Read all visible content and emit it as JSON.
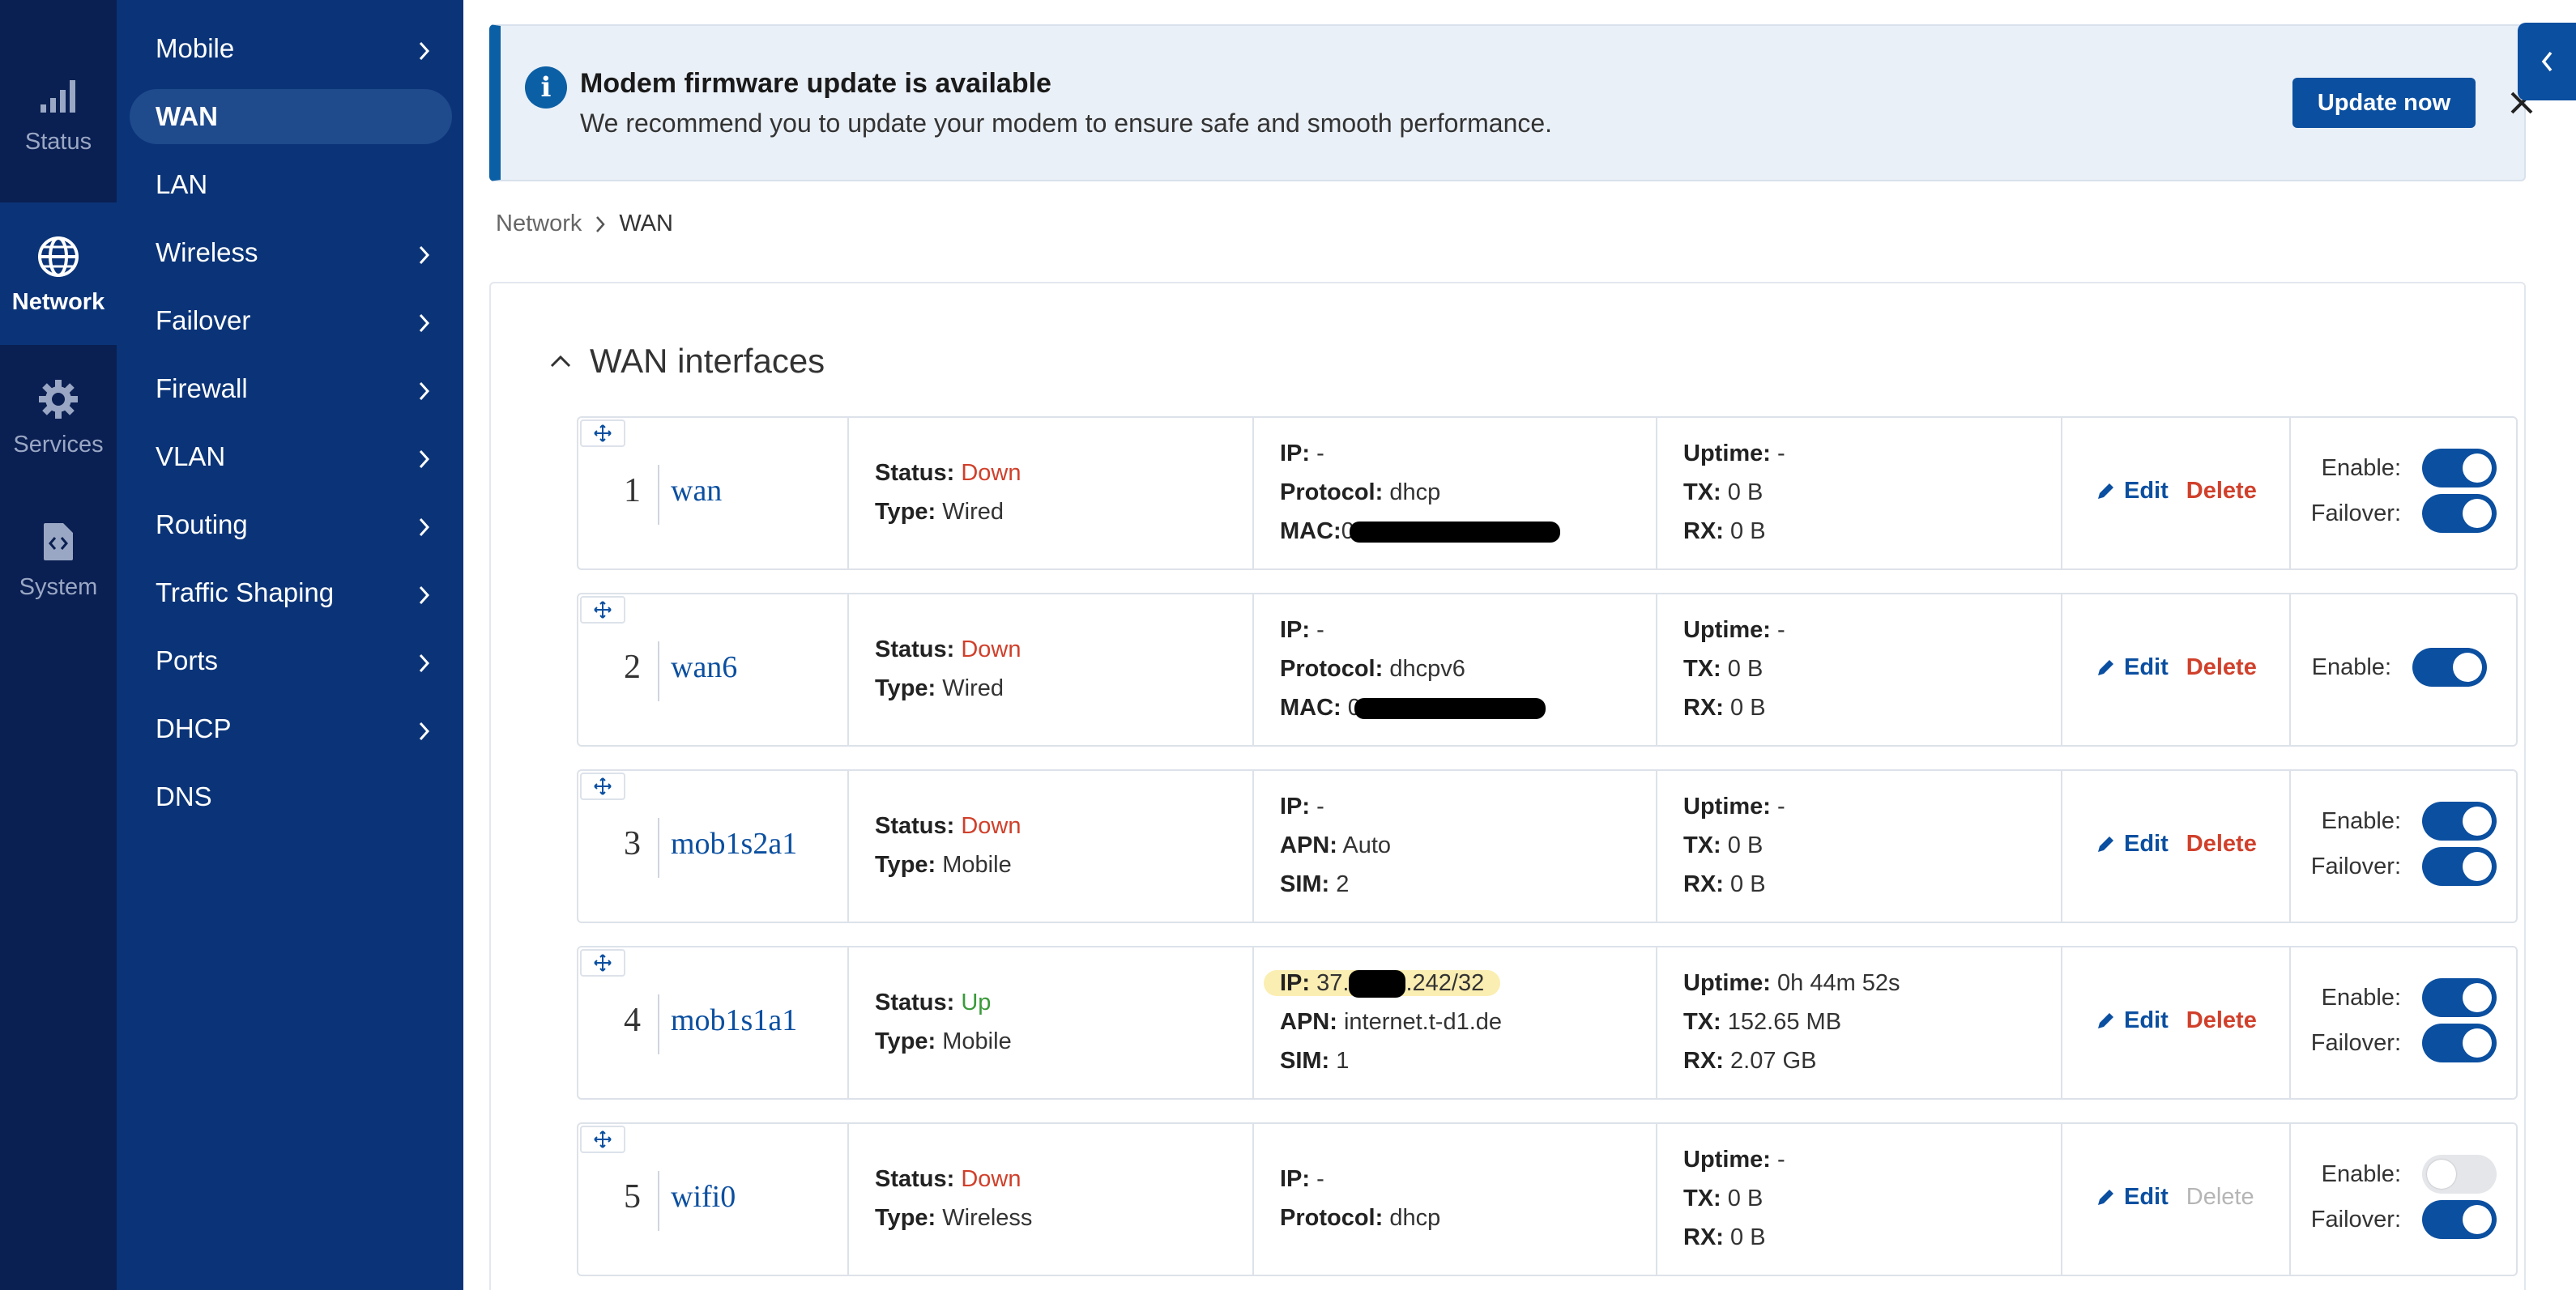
{
  "rail": {
    "items": [
      {
        "label": "Status",
        "icon": "signal-bars-icon"
      },
      {
        "label": "Network",
        "icon": "globe-icon"
      },
      {
        "label": "Services",
        "icon": "gear-icon"
      },
      {
        "label": "System",
        "icon": "code-file-icon"
      }
    ],
    "active": "Network"
  },
  "submenu": {
    "items": [
      {
        "label": "Mobile",
        "has_chevron": true
      },
      {
        "label": "WAN",
        "has_chevron": false,
        "active": true
      },
      {
        "label": "LAN",
        "has_chevron": false
      },
      {
        "label": "Wireless",
        "has_chevron": true
      },
      {
        "label": "Failover",
        "has_chevron": true
      },
      {
        "label": "Firewall",
        "has_chevron": true
      },
      {
        "label": "VLAN",
        "has_chevron": true
      },
      {
        "label": "Routing",
        "has_chevron": true
      },
      {
        "label": "Traffic Shaping",
        "has_chevron": true
      },
      {
        "label": "Ports",
        "has_chevron": true
      },
      {
        "label": "DHCP",
        "has_chevron": true
      },
      {
        "label": "DNS",
        "has_chevron": false
      }
    ]
  },
  "banner": {
    "title": "Modem firmware update is available",
    "description": "We recommend you to update your modem to ensure safe and smooth performance.",
    "button": "Update now"
  },
  "breadcrumb": {
    "parent": "Network",
    "current": "WAN"
  },
  "section": {
    "title": "WAN interfaces"
  },
  "labels": {
    "status": "Status:",
    "type": "Type:",
    "ip": "IP:",
    "protocol": "Protocol:",
    "apn": "APN:",
    "sim": "SIM:",
    "mac": "MAC:",
    "uptime": "Uptime:",
    "tx": "TX:",
    "rx": "RX:",
    "edit": "Edit",
    "delete": "Delete",
    "enable": "Enable:",
    "failover": "Failover:"
  },
  "interfaces": [
    {
      "index": "1",
      "name": "wan",
      "status": "Down",
      "type": "Wired",
      "ip": "-",
      "protocol": "dhcp",
      "mac": "0",
      "uptime": "-",
      "tx": "0 B",
      "rx": "0 B",
      "enable": true,
      "failover": true
    },
    {
      "index": "2",
      "name": "wan6",
      "status": "Down",
      "type": "Wired",
      "ip": "-",
      "protocol": "dhcpv6",
      "mac": "0",
      "uptime": "-",
      "tx": "0 B",
      "rx": "0 B",
      "enable": true
    },
    {
      "index": "3",
      "name": "mob1s2a1",
      "status": "Down",
      "type": "Mobile",
      "ip": "-",
      "apn": "Auto",
      "sim": "2",
      "uptime": "-",
      "tx": "0 B",
      "rx": "0 B",
      "enable": true,
      "failover": true
    },
    {
      "index": "4",
      "name": "mob1s1a1",
      "status": "Up",
      "type": "Mobile",
      "ip_prefix": "37.",
      "ip_suffix": ".242/32",
      "apn": "internet.t-d1.de",
      "sim": "1",
      "uptime": "0h 44m 52s",
      "tx": "152.65 MB",
      "rx": "2.07 GB",
      "enable": true,
      "failover": true
    },
    {
      "index": "5",
      "name": "wifi0",
      "status": "Down",
      "type": "Wireless",
      "ip": "-",
      "protocol": "dhcp",
      "uptime": "-",
      "tx": "0 B",
      "rx": "0 B",
      "enable": false,
      "failover": true,
      "delete_disabled": true
    }
  ],
  "colors": {
    "sidebar_dark": "#0a1f52",
    "sidebar": "#0b3478",
    "accent": "#0b4fa0",
    "status_down": "#d0402b",
    "status_up": "#3a9a3a"
  }
}
